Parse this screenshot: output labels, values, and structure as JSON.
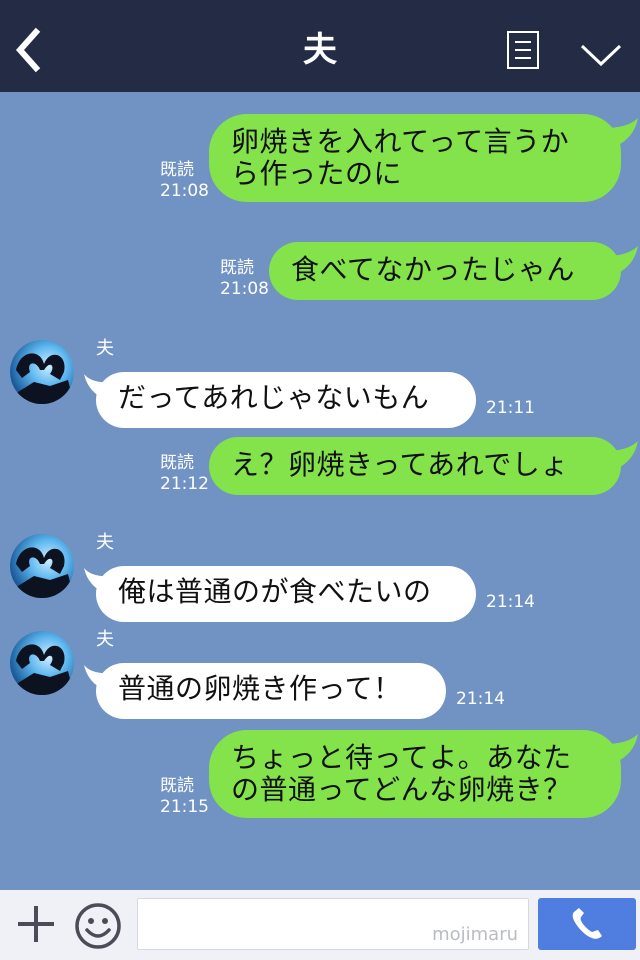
{
  "header": {
    "title": "夫"
  },
  "messages": [
    {
      "from": "me",
      "lines": [
        "卵焼きを入れてって言うか",
        "ら作ったのに"
      ],
      "read": "既読",
      "time": "21:08"
    },
    {
      "from": "me",
      "lines": [
        "食べてなかったじゃん"
      ],
      "read": "既読",
      "time": "21:08"
    },
    {
      "from": "them",
      "sender": "夫",
      "lines": [
        "だってあれじゃないもん"
      ],
      "time": "21:11"
    },
    {
      "from": "me",
      "lines": [
        "え？卵焼きってあれでしょ"
      ],
      "read": "既読",
      "time": "21:12"
    },
    {
      "from": "them",
      "sender": "夫",
      "lines": [
        "俺は普通のが食べたいの"
      ],
      "time": "21:14"
    },
    {
      "from": "them",
      "sender": "夫",
      "lines": [
        "普通の卵焼き作って！"
      ],
      "time": "21:14"
    },
    {
      "from": "me",
      "lines": [
        "ちょっと待ってよ。あなた",
        "の普通ってどんな卵焼き？"
      ],
      "read": "既読",
      "time": "21:15"
    }
  ],
  "footer": {
    "watermark": "mojimaru"
  },
  "colors": {
    "header_bg": "#242b44",
    "chat_bg": "#7193c4",
    "my_bubble": "#84e24a",
    "their_bubble": "#ffffff",
    "call_button": "#4f7de0"
  },
  "icons": [
    "back-arrow-icon",
    "menu-list-icon",
    "chevron-down-icon",
    "plus-icon",
    "smiley-icon",
    "phone-icon"
  ]
}
